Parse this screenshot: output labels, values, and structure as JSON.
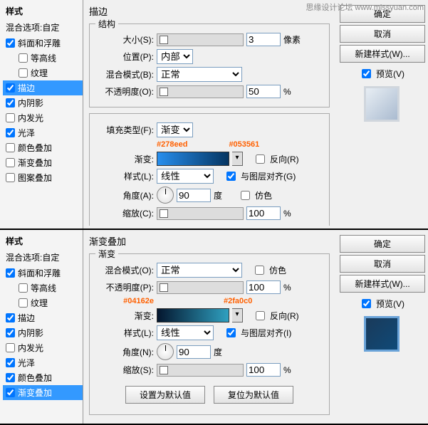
{
  "watermark": "思缘设计论坛  www.missyuan.com",
  "top": {
    "title": "描边",
    "styles_header": "样式",
    "blend_options": "混合选项:自定",
    "items": [
      {
        "label": "斜面和浮雕",
        "checked": true,
        "sel": false
      },
      {
        "label": "等高线",
        "checked": false,
        "sel": false,
        "indent": true
      },
      {
        "label": "纹理",
        "checked": false,
        "sel": false,
        "indent": true
      },
      {
        "label": "描边",
        "checked": true,
        "sel": true
      },
      {
        "label": "内阴影",
        "checked": true,
        "sel": false
      },
      {
        "label": "内发光",
        "checked": false,
        "sel": false
      },
      {
        "label": "光泽",
        "checked": true,
        "sel": false
      },
      {
        "label": "颜色叠加",
        "checked": false,
        "sel": false
      },
      {
        "label": "渐变叠加",
        "checked": false,
        "sel": false
      },
      {
        "label": "图案叠加",
        "checked": false,
        "sel": false
      }
    ],
    "struct": {
      "legend": "结构",
      "size_label": "大小(S):",
      "size_val": "3",
      "size_unit": "像素",
      "pos_label": "位置(P):",
      "pos_val": "内部",
      "blend_label": "混合模式(B):",
      "blend_val": "正常",
      "opacity_label": "不透明度(O):",
      "opacity_val": "50",
      "opacity_unit": "%"
    },
    "fill": {
      "fill_type_label": "填充类型(F):",
      "fill_type_val": "渐变",
      "ann_left": "#278eed",
      "ann_right": "#053561",
      "grad_label": "渐变:",
      "reverse": "反向(R)",
      "style_label": "样式(L):",
      "style_val": "线性",
      "align": "与图层对齐(G)",
      "angle_label": "角度(A):",
      "angle_val": "90",
      "angle_unit": "度",
      "dither": "仿色",
      "scale_label": "缩放(C):",
      "scale_val": "100",
      "scale_unit": "%"
    },
    "buttons": {
      "ok": "确定",
      "cancel": "取消",
      "new": "新建样式(W)...",
      "preview": "预览(V)"
    }
  },
  "bottom": {
    "title": "渐变叠加",
    "styles_header": "样式",
    "blend_options": "混合选项:自定",
    "items": [
      {
        "label": "斜面和浮雕",
        "checked": true,
        "sel": false
      },
      {
        "label": "等高线",
        "checked": false,
        "sel": false,
        "indent": true
      },
      {
        "label": "纹理",
        "checked": false,
        "sel": false,
        "indent": true
      },
      {
        "label": "描边",
        "checked": true,
        "sel": false
      },
      {
        "label": "内阴影",
        "checked": true,
        "sel": false
      },
      {
        "label": "内发光",
        "checked": false,
        "sel": false
      },
      {
        "label": "光泽",
        "checked": true,
        "sel": false
      },
      {
        "label": "颜色叠加",
        "checked": true,
        "sel": false
      },
      {
        "label": "渐变叠加",
        "checked": true,
        "sel": true
      }
    ],
    "grad": {
      "legend": "渐变",
      "blend_label": "混合模式(O):",
      "blend_val": "正常",
      "dither": "仿色",
      "opacity_label": "不透明度(P):",
      "opacity_val": "100",
      "opacity_unit": "%",
      "ann_left": "#04162e",
      "ann_right": "#2fa0c0",
      "grad_label": "渐变:",
      "reverse": "反向(R)",
      "style_label": "样式(L):",
      "style_val": "线性",
      "align": "与图层对齐(I)",
      "angle_label": "角度(N):",
      "angle_val": "90",
      "angle_unit": "度",
      "scale_label": "缩放(S):",
      "scale_val": "100",
      "scale_unit": "%",
      "set_default": "设置为默认值",
      "reset_default": "复位为默认值"
    },
    "buttons": {
      "ok": "确定",
      "cancel": "取消",
      "new": "新建样式(W)...",
      "preview": "预览(V)"
    }
  }
}
